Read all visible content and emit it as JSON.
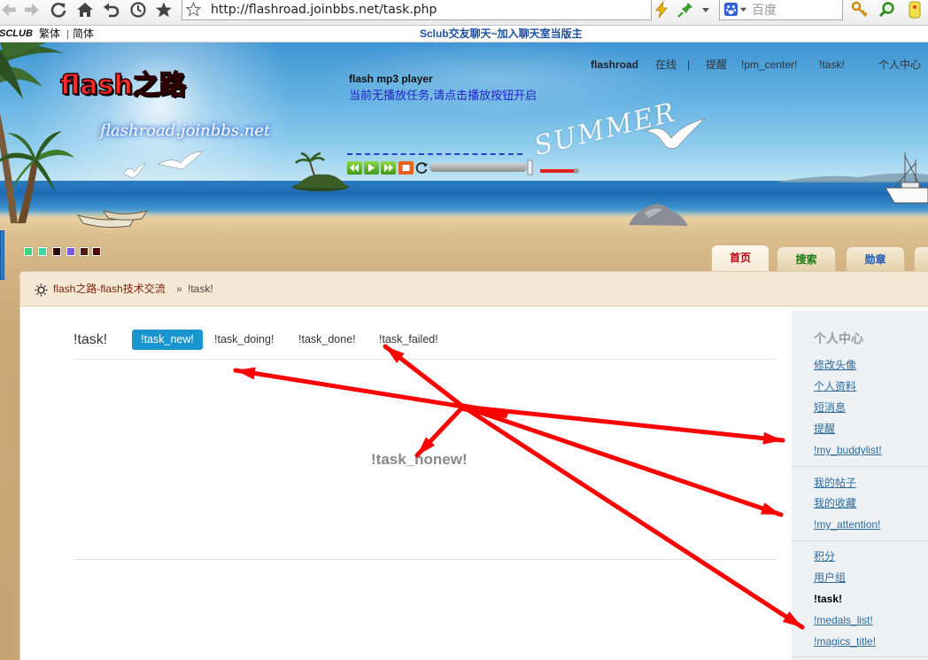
{
  "browser": {
    "url": "http://flashroad.joinbbs.net/task.php",
    "search_placeholder": "百度"
  },
  "topbar": {
    "brand": "SCLUB",
    "traditional": "繁体",
    "separator": "|",
    "simplified": "简体",
    "promo": "Sclub交友聊天~加入聊天室当版主"
  },
  "header": {
    "logo": "flash之路",
    "domain": "flashroad.joinbbs.net",
    "artwork_text": "SUMMER",
    "player": {
      "title": "flash mp3 player",
      "status": "当前无播放任务,请点击播放按钮开启"
    },
    "user": "flashroad",
    "online": "在线",
    "separator": "|",
    "links": [
      "提醒",
      "!pm_center!",
      "!task!",
      "个人中心"
    ]
  },
  "style_swatches": [
    "#3fd37f",
    "#3fd9a6",
    "#2b0c0c",
    "#7a5ad8",
    "#4d1a12",
    "#4b0b0b"
  ],
  "nav_tabs": [
    {
      "label": "首页",
      "color": "#b3000c",
      "active": true
    },
    {
      "label": "搜索",
      "color": "#1a7a12",
      "active": false
    },
    {
      "label": "勋章",
      "color": "#1d5bb6",
      "active": false
    }
  ],
  "breadcrumb": {
    "forum": "flash之路-flash技术交流",
    "separator": "»",
    "current": "!task!"
  },
  "main": {
    "title": "!task!",
    "tabs": [
      {
        "label": "!task_new!",
        "active": true
      },
      {
        "label": "!task_doing!",
        "active": false
      },
      {
        "label": "!task_done!",
        "active": false
      },
      {
        "label": "!task_failed!",
        "active": false
      }
    ],
    "empty_message": "!task_nonew!"
  },
  "sidebar": {
    "title": "个人中心",
    "groups": [
      [
        {
          "label": "修改头像"
        },
        {
          "label": "个人资料"
        },
        {
          "label": "短消息"
        },
        {
          "label": "提醒"
        },
        {
          "label": "!my_buddylist!"
        }
      ],
      [
        {
          "label": "我的帖子"
        },
        {
          "label": "我的收藏"
        },
        {
          "label": "!my_attention!"
        }
      ],
      [
        {
          "label": "积分"
        },
        {
          "label": "用户组"
        },
        {
          "label": "!task!",
          "current": true
        },
        {
          "label": "!medals_list!"
        },
        {
          "label": "!magics_title!"
        }
      ]
    ]
  },
  "colors": {
    "accent": "#1b95cf",
    "link": "#2e6b9e",
    "annotation": "#ff0000"
  }
}
